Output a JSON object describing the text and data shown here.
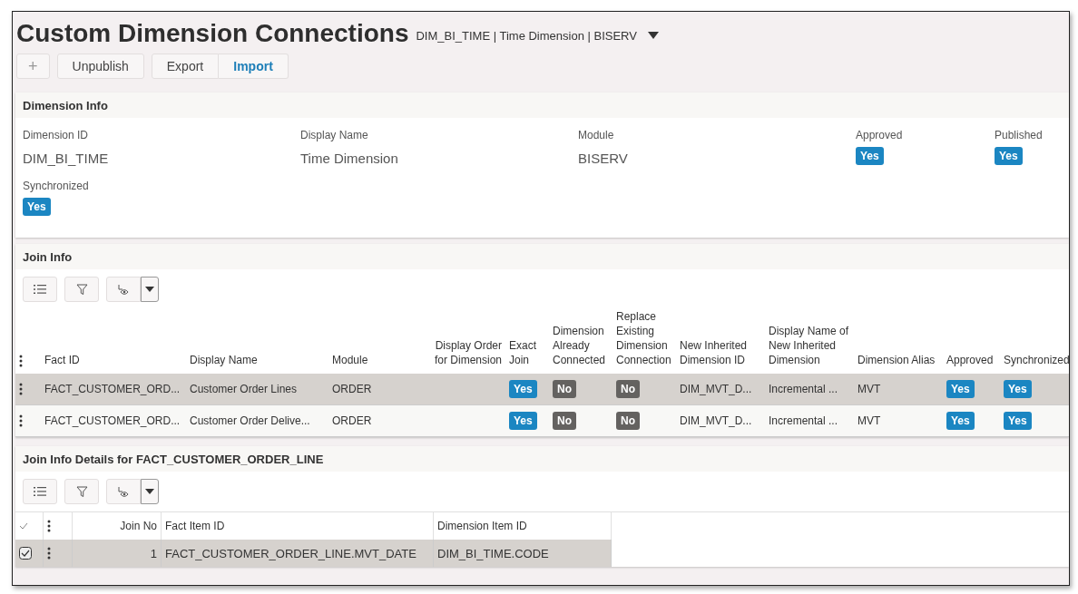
{
  "page": {
    "title": "Custom Dimension Connections",
    "context": "DIM_BI_TIME | Time Dimension | BISERV"
  },
  "toolbar": [
    {
      "label": "+",
      "kind": "icon"
    },
    {
      "label": "Unpublish",
      "kind": "single"
    },
    {
      "label": "Export",
      "kind": "group-first"
    },
    {
      "label": "Import",
      "kind": "group-last"
    }
  ],
  "dimension_info": {
    "title": "Dimension Info",
    "fields": [
      {
        "label": "Dimension ID",
        "kind": "text",
        "value": "DIM_BI_TIME"
      },
      {
        "label": "Display Name",
        "kind": "text",
        "value": "Time Dimension"
      },
      {
        "label": "Module",
        "kind": "text",
        "value": "BISERV"
      },
      {
        "label": "Approved",
        "kind": "badge",
        "value": "Yes",
        "on": true
      },
      {
        "label": "Published",
        "kind": "badge",
        "value": "Yes",
        "on": true
      },
      {
        "label": "Synchronized",
        "kind": "badge",
        "value": "Yes",
        "on": true
      }
    ]
  },
  "join_info": {
    "title": "Join Info",
    "columns": [
      {
        "label": "Fact ID",
        "kind": "text"
      },
      {
        "label": "Display Name",
        "kind": "text"
      },
      {
        "label": "Module",
        "kind": "text"
      },
      {
        "label": "Display Order for Dimension",
        "kind": "number"
      },
      {
        "label": "Exact Join",
        "kind": "badge"
      },
      {
        "label": "Dimension Already Connected",
        "kind": "badge"
      },
      {
        "label": "Replace Existing Dimension Connection",
        "kind": "badge"
      },
      {
        "label": "New Inherited Dimension ID",
        "kind": "text"
      },
      {
        "label": "Display Name of New Inherited Dimension",
        "kind": "text"
      },
      {
        "label": "Dimension Alias",
        "kind": "text"
      },
      {
        "label": "Approved",
        "kind": "badge"
      },
      {
        "label": "Synchronized",
        "kind": "badge"
      }
    ],
    "rows": [
      {
        "selected": true,
        "cells": [
          {
            "text": "FACT_CUSTOMER_ORD..."
          },
          {
            "text": "Customer Order Lines"
          },
          {
            "text": "ORDER"
          },
          {},
          {
            "text": "Yes",
            "on": true
          },
          {
            "text": "No",
            "on": false
          },
          {
            "text": "No",
            "on": false
          },
          {
            "text": "DIM_MVT_D..."
          },
          {
            "text": "Incremental ..."
          },
          {
            "text": "MVT"
          },
          {
            "text": "Yes",
            "on": true
          },
          {
            "text": "Yes",
            "on": true
          }
        ]
      },
      {
        "selected": false,
        "cells": [
          {
            "text": "FACT_CUSTOMER_ORD..."
          },
          {
            "text": "Customer Order Delive..."
          },
          {
            "text": "ORDER"
          },
          {},
          {
            "text": "Yes",
            "on": true
          },
          {
            "text": "No",
            "on": false
          },
          {
            "text": "No",
            "on": false
          },
          {
            "text": "DIM_MVT_D..."
          },
          {
            "text": "Incremental ..."
          },
          {
            "text": "MVT"
          },
          {
            "text": "Yes",
            "on": true
          },
          {
            "text": "Yes",
            "on": true
          }
        ]
      }
    ]
  },
  "join_details": {
    "title": "Join Info Details for FACT_CUSTOMER_ORDER_LINE",
    "columns": [
      {
        "label": "Join No",
        "kind": "number"
      },
      {
        "label": "Fact Item ID",
        "kind": "text"
      },
      {
        "label": "Dimension Item ID",
        "kind": "text"
      }
    ],
    "rows": [
      {
        "selected": true,
        "checked": true,
        "cells": [
          "1",
          "FACT_CUSTOMER_ORDER_LINE.MVT_DATE",
          "DIM_BI_TIME.CODE"
        ]
      }
    ]
  }
}
